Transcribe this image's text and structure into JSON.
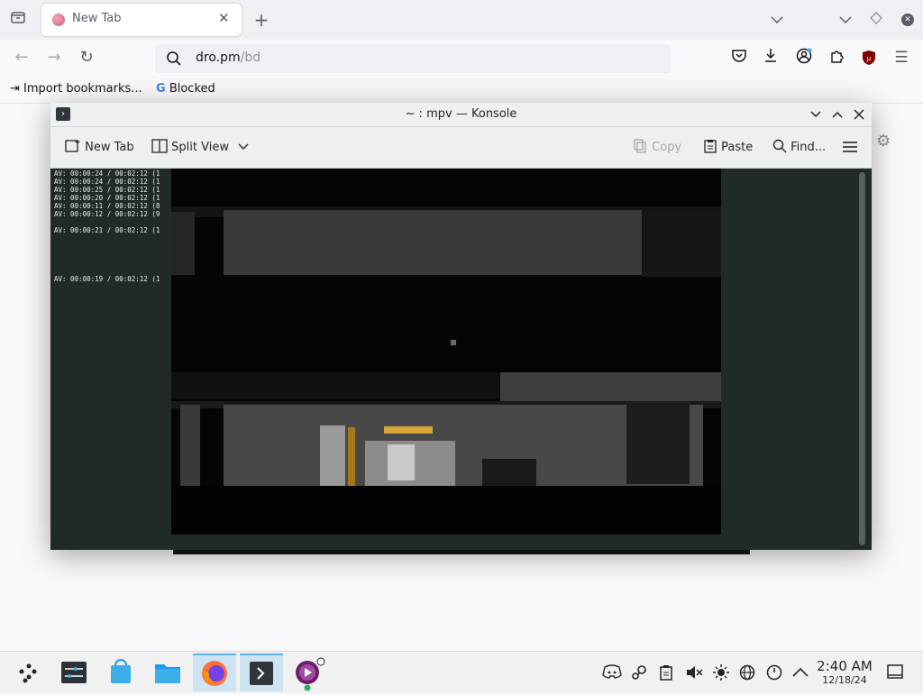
{
  "browser": {
    "tab_title": "New Tab",
    "tab_close": "✕",
    "new_tab": "+",
    "url_host": "dro.pm",
    "url_path": "/bd",
    "bookmarks": [
      "Import bookmarks...",
      "Blocked"
    ],
    "bookmark_g": "G"
  },
  "konsole": {
    "title": "~ : mpv — Konsole",
    "toolbar": {
      "new_tab": "New Tab",
      "split_view": "Split View",
      "copy": "Copy",
      "paste": "Paste",
      "find": "Find..."
    },
    "av_lines": [
      "AV: 00:00:24 / 00:02:12 (1",
      "AV: 00:00:24 / 00:02:12 (1",
      "AV: 00:00:25 / 00:02:12 (1",
      "AV: 00:00:20 / 00:02:12 (1",
      "AV: 00:00:11 / 00:02:12 (8",
      "AV: 00:00:12 / 00:02:12 (9",
      "AV: 00:00:21 / 00:02:12 (1",
      "AV: 00:00:19 / 00:02:12 (1"
    ]
  },
  "clock": {
    "time": "2:40 AM",
    "date": "12/18/24"
  },
  "colors": {
    "accent": "#5eb3e4",
    "terminal_bg": "#202a27",
    "ublock": "#800000"
  }
}
